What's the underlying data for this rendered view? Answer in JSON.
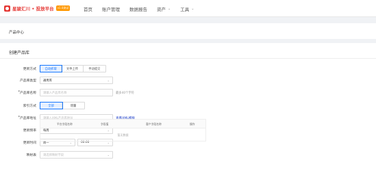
{
  "header": {
    "logo_text": "星骏汇川 • 投放平台",
    "logo_badge": "v1.0测试",
    "nav": [
      {
        "label": "首页",
        "has_dropdown": false
      },
      {
        "label": "账户管理",
        "has_dropdown": false
      },
      {
        "label": "数据报告",
        "has_dropdown": false
      },
      {
        "label": "资产",
        "has_dropdown": true
      },
      {
        "label": "工具",
        "has_dropdown": true
      }
    ]
  },
  "breadcrumb": {
    "title": "产品中心"
  },
  "form": {
    "section_title": "创建产品库",
    "update_method": {
      "label": "更新方式",
      "options": [
        "自动抓取",
        "文件上传",
        "手动提交"
      ],
      "selected": 0
    },
    "product_type": {
      "label": "产品库类型",
      "value": "通用库"
    },
    "product_name": {
      "label": "产品库名称",
      "required": true,
      "placeholder": "请输入产品库名称",
      "hint": "最多40个字符"
    },
    "index_method": {
      "label": "索引方式",
      "options": [
        "全部",
        "增量"
      ],
      "selected": 0
    },
    "product_url": {
      "label": "产品库地址",
      "required": true,
      "placeholder": "请输入XML产品库地址",
      "link": "查看XML模板"
    },
    "update_frequency": {
      "label": "更新频率",
      "value": "每周"
    },
    "update_time": {
      "label": "更新时间",
      "day": "周一",
      "time": "00:00"
    },
    "mapping": {
      "label": "映射表",
      "placeholder": "请选择映射字段",
      "columns": [
        "平台字段名称",
        "字段值",
        "客户字段名称",
        "操作"
      ],
      "empty_text": "暂无数据"
    }
  }
}
